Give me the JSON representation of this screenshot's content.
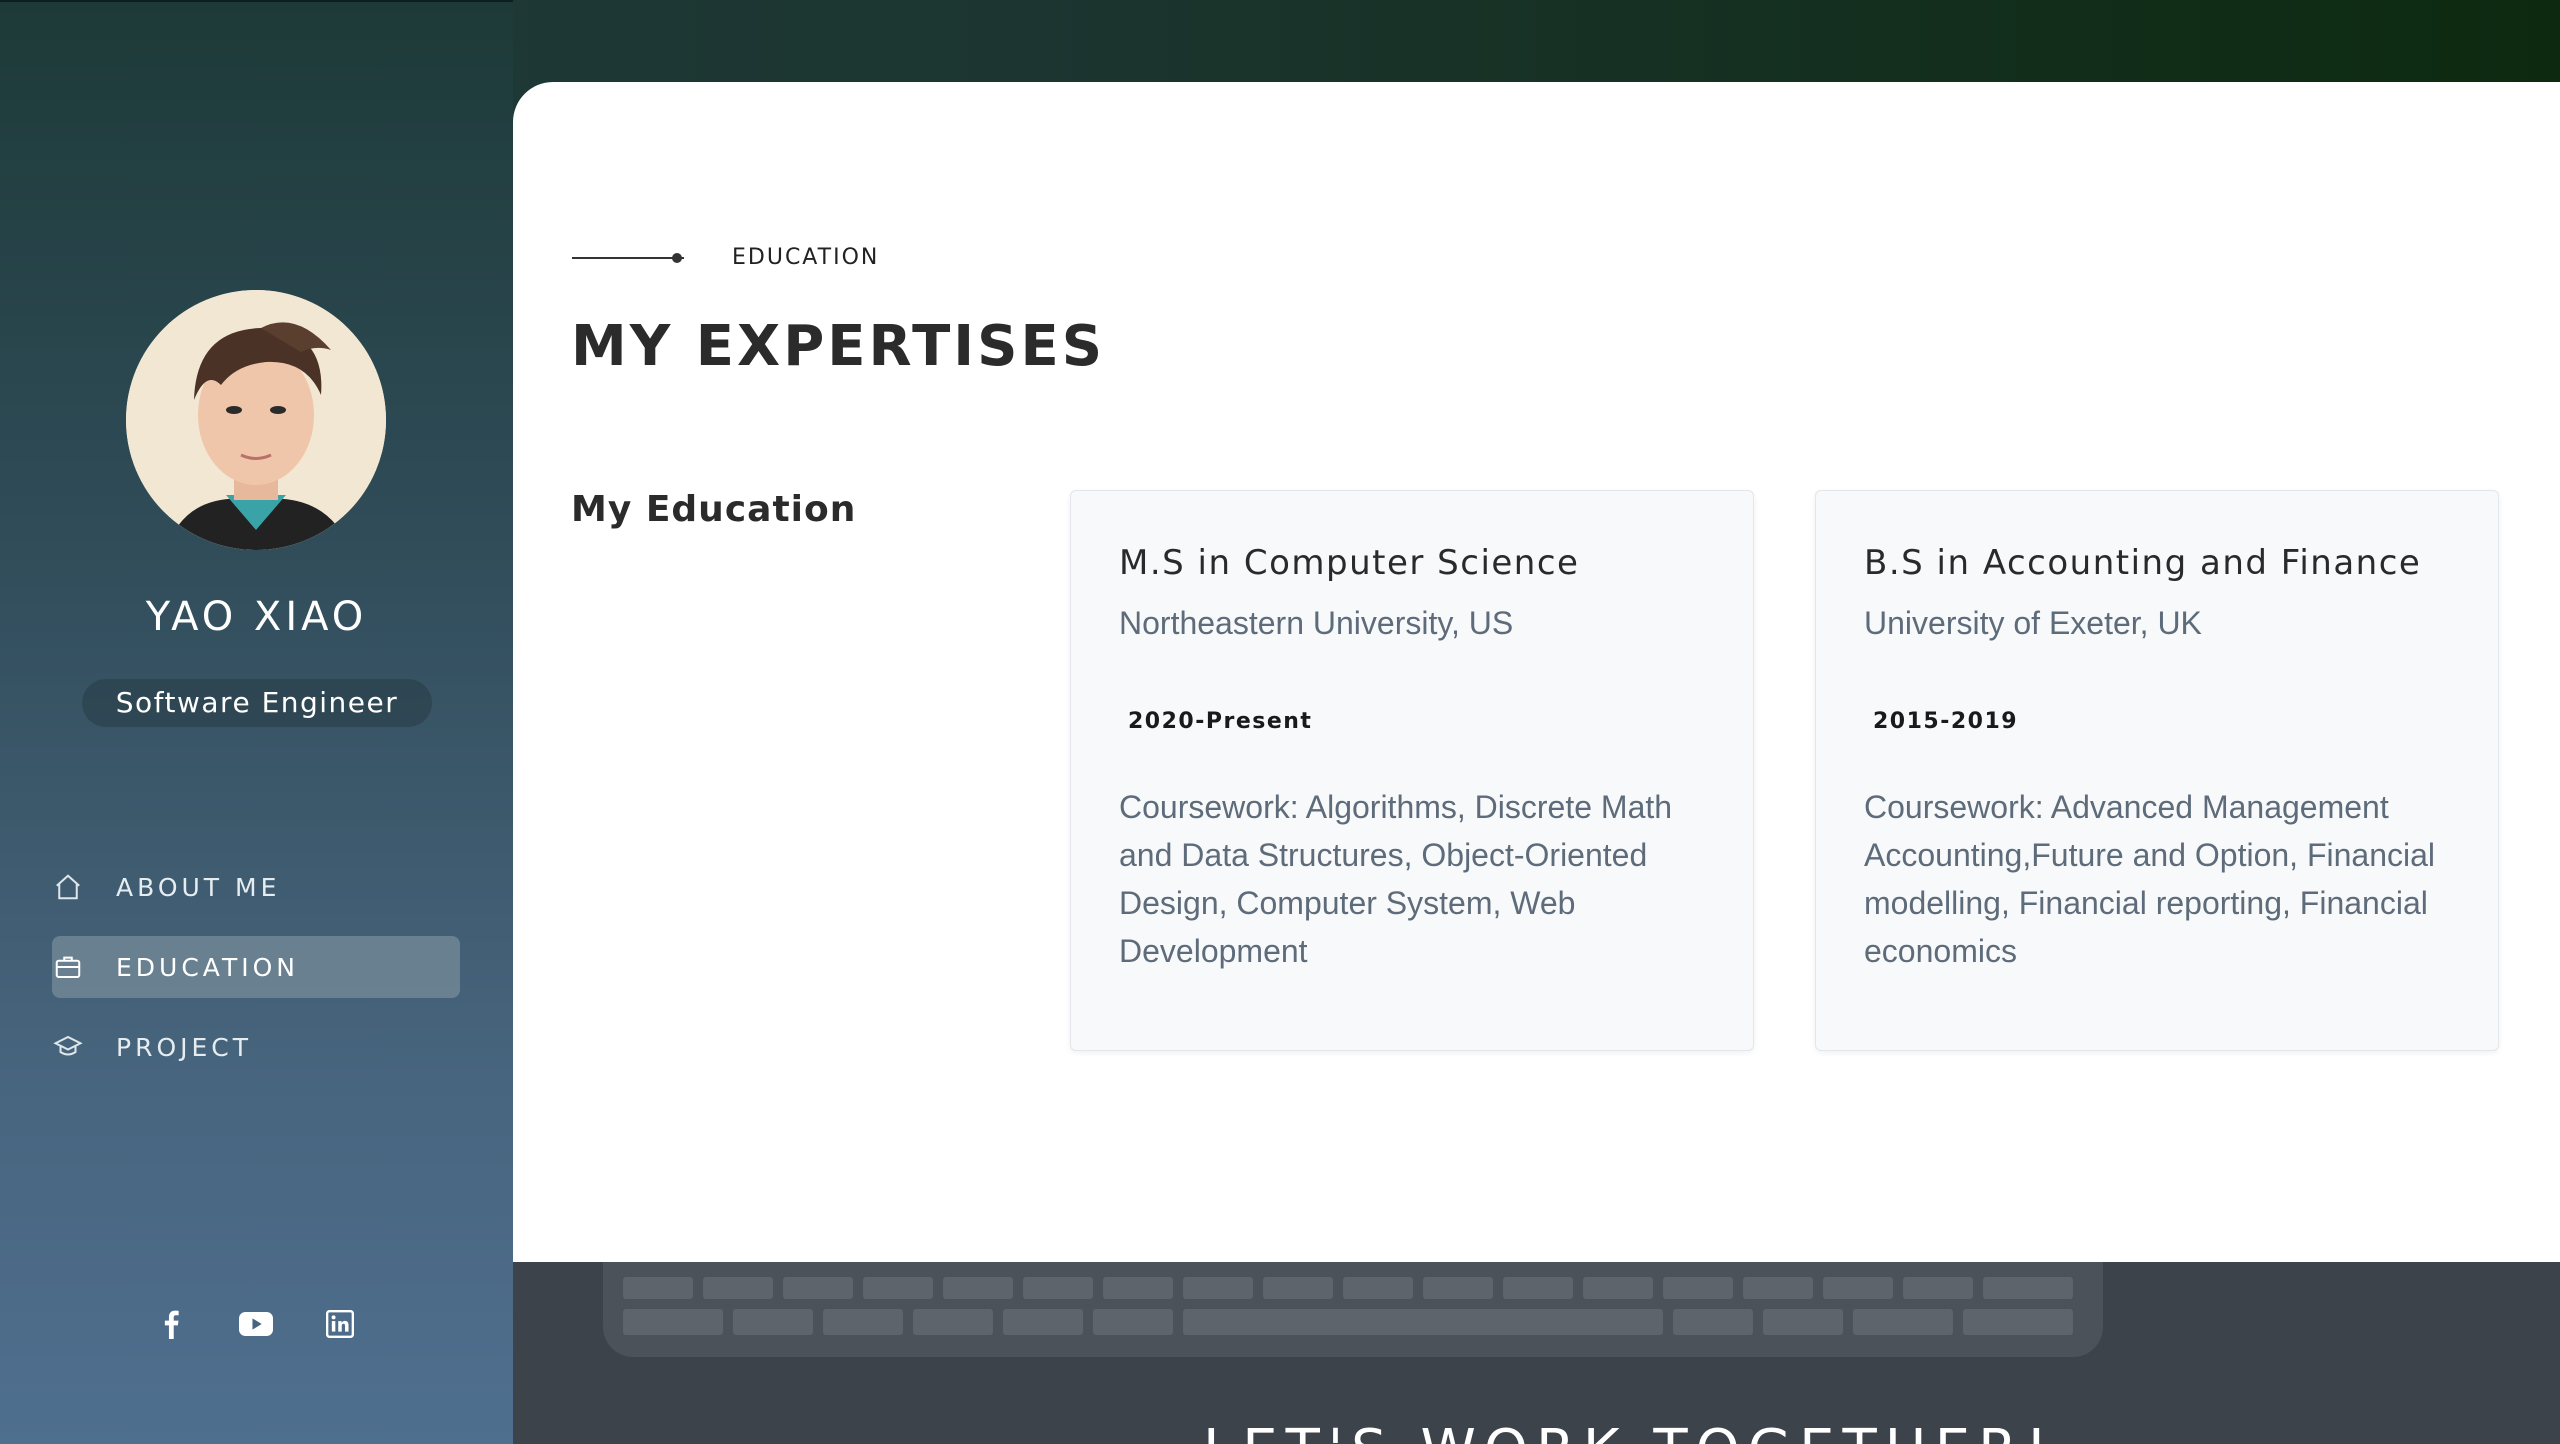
{
  "sidebar": {
    "name": "YAO XIAO",
    "role": "Software Engineer",
    "nav": [
      {
        "label": "ABOUT ME",
        "icon": "home-icon"
      },
      {
        "label": "EDUCATION",
        "icon": "briefcase-icon",
        "active": true
      },
      {
        "label": "PROJECT",
        "icon": "graduation-cap-icon"
      }
    ],
    "social": [
      {
        "icon": "facebook-icon"
      },
      {
        "icon": "youtube-icon"
      },
      {
        "icon": "linkedin-icon"
      }
    ]
  },
  "main": {
    "eyebrow": "EDUCATION",
    "title": "MY EXPERTISES",
    "section_title": "My Education",
    "cards": [
      {
        "degree": "M.S in Computer Science",
        "school": "Northeastern University, US",
        "years": "2020-Present",
        "description": "Coursework: Algorithms, Discrete Math and Data Structures, Object-Oriented Design, Computer System, Web Development"
      },
      {
        "degree": "B.S in Accounting and Finance",
        "school": "University of Exeter, UK",
        "years": "2015-2019",
        "description": "Coursework: Advanced Management Accounting,Future and Option, Financial modelling, Financial reporting,  Financial economics"
      }
    ]
  },
  "footer": {
    "heading": "LET'S WORK TOGETHER!"
  },
  "colors": {
    "sidebar_top": "#1d3a38",
    "sidebar_bottom": "#4f6f8f",
    "card_bg": "#f8f9fa",
    "muted_text": "#5d6b7a"
  }
}
